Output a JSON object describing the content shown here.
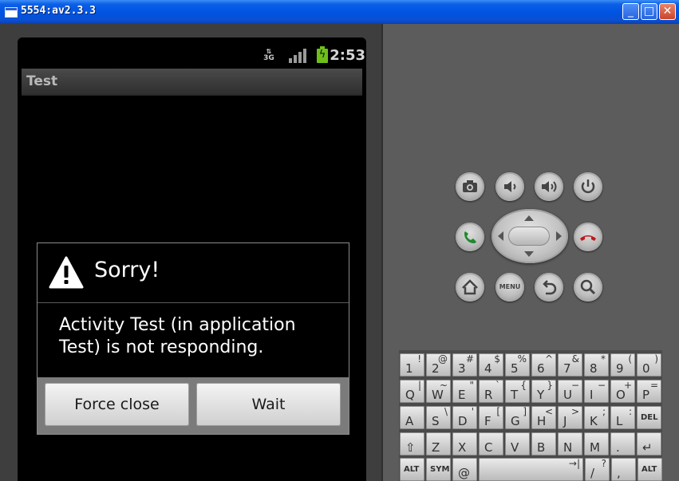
{
  "window": {
    "title": "5554:av2.3.3",
    "minimize_glyph": "_",
    "maximize_glyph": "□",
    "close_glyph": "✕"
  },
  "status_bar": {
    "network": "3G",
    "time": "2:53"
  },
  "app": {
    "title": "Test"
  },
  "dialog": {
    "title": "Sorry!",
    "message": "Activity Test (in application Test) is not responding.",
    "buttons": {
      "force_close": "Force close",
      "wait": "Wait"
    }
  },
  "hardware": {
    "menu_label": "MENU"
  },
  "keyboard": {
    "rows": [
      [
        {
          "m": "1",
          "s": "!"
        },
        {
          "m": "2",
          "s": "@"
        },
        {
          "m": "3",
          "s": "#"
        },
        {
          "m": "4",
          "s": "$"
        },
        {
          "m": "5",
          "s": "%"
        },
        {
          "m": "6",
          "s": "^"
        },
        {
          "m": "7",
          "s": "&"
        },
        {
          "m": "8",
          "s": "*"
        },
        {
          "m": "9",
          "s": "("
        },
        {
          "m": "0",
          "s": ")"
        }
      ],
      [
        {
          "m": "Q",
          "s": "|"
        },
        {
          "m": "W",
          "s": "~"
        },
        {
          "m": "E",
          "s": "\""
        },
        {
          "m": "R",
          "s": "`"
        },
        {
          "m": "T",
          "s": "{"
        },
        {
          "m": "Y",
          "s": "}"
        },
        {
          "m": "U",
          "s": "−"
        },
        {
          "m": "I",
          "s": "−"
        },
        {
          "m": "O",
          "s": "+"
        },
        {
          "m": "P",
          "s": "="
        }
      ],
      [
        {
          "m": "A",
          "s": ""
        },
        {
          "m": "S",
          "s": "\\"
        },
        {
          "m": "D",
          "s": "'"
        },
        {
          "m": "F",
          "s": "["
        },
        {
          "m": "G",
          "s": "]"
        },
        {
          "m": "H",
          "s": "<"
        },
        {
          "m": "J",
          "s": ">"
        },
        {
          "m": "K",
          "s": ";"
        },
        {
          "m": "L",
          "s": ":"
        },
        {
          "m": "DEL",
          "s": ""
        }
      ],
      [
        {
          "m": "⇧",
          "s": ""
        },
        {
          "m": "Z",
          "s": ""
        },
        {
          "m": "X",
          "s": ""
        },
        {
          "m": "C",
          "s": ""
        },
        {
          "m": "V",
          "s": ""
        },
        {
          "m": "B",
          "s": ""
        },
        {
          "m": "N",
          "s": ""
        },
        {
          "m": "M",
          "s": ""
        },
        {
          "m": ".",
          "s": ""
        },
        {
          "m": "↵",
          "s": ""
        }
      ],
      [
        {
          "m": "ALT",
          "s": ""
        },
        {
          "m": "SYM",
          "s": ""
        },
        {
          "m": "@",
          "s": ""
        },
        {
          "m": "",
          "s": "→|"
        },
        {
          "m": "/",
          "s": "?"
        },
        {
          "m": ",",
          "s": ""
        },
        {
          "m": "ALT",
          "s": ""
        }
      ]
    ]
  }
}
